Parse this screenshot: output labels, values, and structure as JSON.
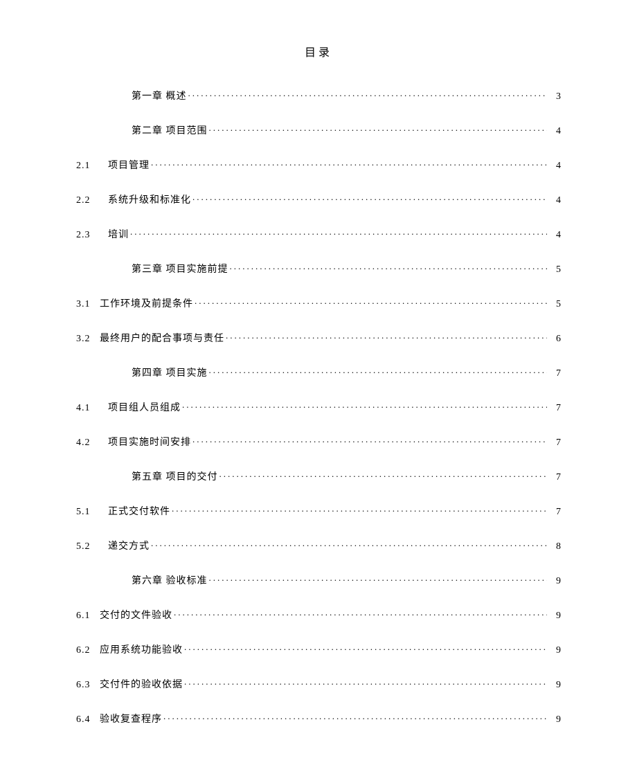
{
  "title": "目录",
  "entries": [
    {
      "kind": "chapter",
      "label": "第一章 概述",
      "page": "3"
    },
    {
      "kind": "chapter",
      "label": "第二章 项目范围",
      "page": "4"
    },
    {
      "kind": "sub",
      "num": "2.1",
      "numClass": "wide",
      "label": "项目管理 ",
      "page": "4"
    },
    {
      "kind": "sub",
      "num": "2.2",
      "numClass": "wide",
      "label": "系统升级和标准化 ",
      "page": "4"
    },
    {
      "kind": "sub",
      "num": "2.3",
      "numClass": "wide",
      "label": "培训 ",
      "page": "4"
    },
    {
      "kind": "chapter",
      "label": "第三章 项目实施前提",
      "page": "5"
    },
    {
      "kind": "sub",
      "num": "3.1",
      "numClass": "tight",
      "label": "工作环境及前提条件 ",
      "page": "5"
    },
    {
      "kind": "sub",
      "num": "3.2",
      "numClass": "tight",
      "label": "最终用户的配合事项与责任 ",
      "page": "6"
    },
    {
      "kind": "chapter",
      "label": "第四章 项目实施",
      "page": "7"
    },
    {
      "kind": "sub",
      "num": "4.1",
      "numClass": "wide",
      "label": "项目组人员组成 ",
      "page": "7"
    },
    {
      "kind": "sub",
      "num": "4.2",
      "numClass": "wide",
      "label": "项目实施时间安排 ",
      "page": "7"
    },
    {
      "kind": "chapter",
      "label": "第五章 项目的交付",
      "page": "7"
    },
    {
      "kind": "sub",
      "num": "5.1",
      "numClass": "wide",
      "label": "正式交付软件 ",
      "page": "7"
    },
    {
      "kind": "sub",
      "num": "5.2",
      "numClass": "wide",
      "label": "递交方式 ",
      "page": "8"
    },
    {
      "kind": "chapter",
      "label": "第六章 验收标准",
      "page": "9"
    },
    {
      "kind": "sub",
      "num": "6.1",
      "numClass": "tight",
      "label": "交付的文件验收",
      "page": "9"
    },
    {
      "kind": "sub",
      "num": "6.2",
      "numClass": "tight",
      "label": "应用系统功能验收",
      "page": "9"
    },
    {
      "kind": "sub",
      "num": "6.3",
      "numClass": "tight",
      "label": "交付件的验收依据",
      "page": "9"
    },
    {
      "kind": "sub",
      "num": "6.4",
      "numClass": "tight",
      "label": "验收复查程序",
      "page": "9"
    }
  ]
}
